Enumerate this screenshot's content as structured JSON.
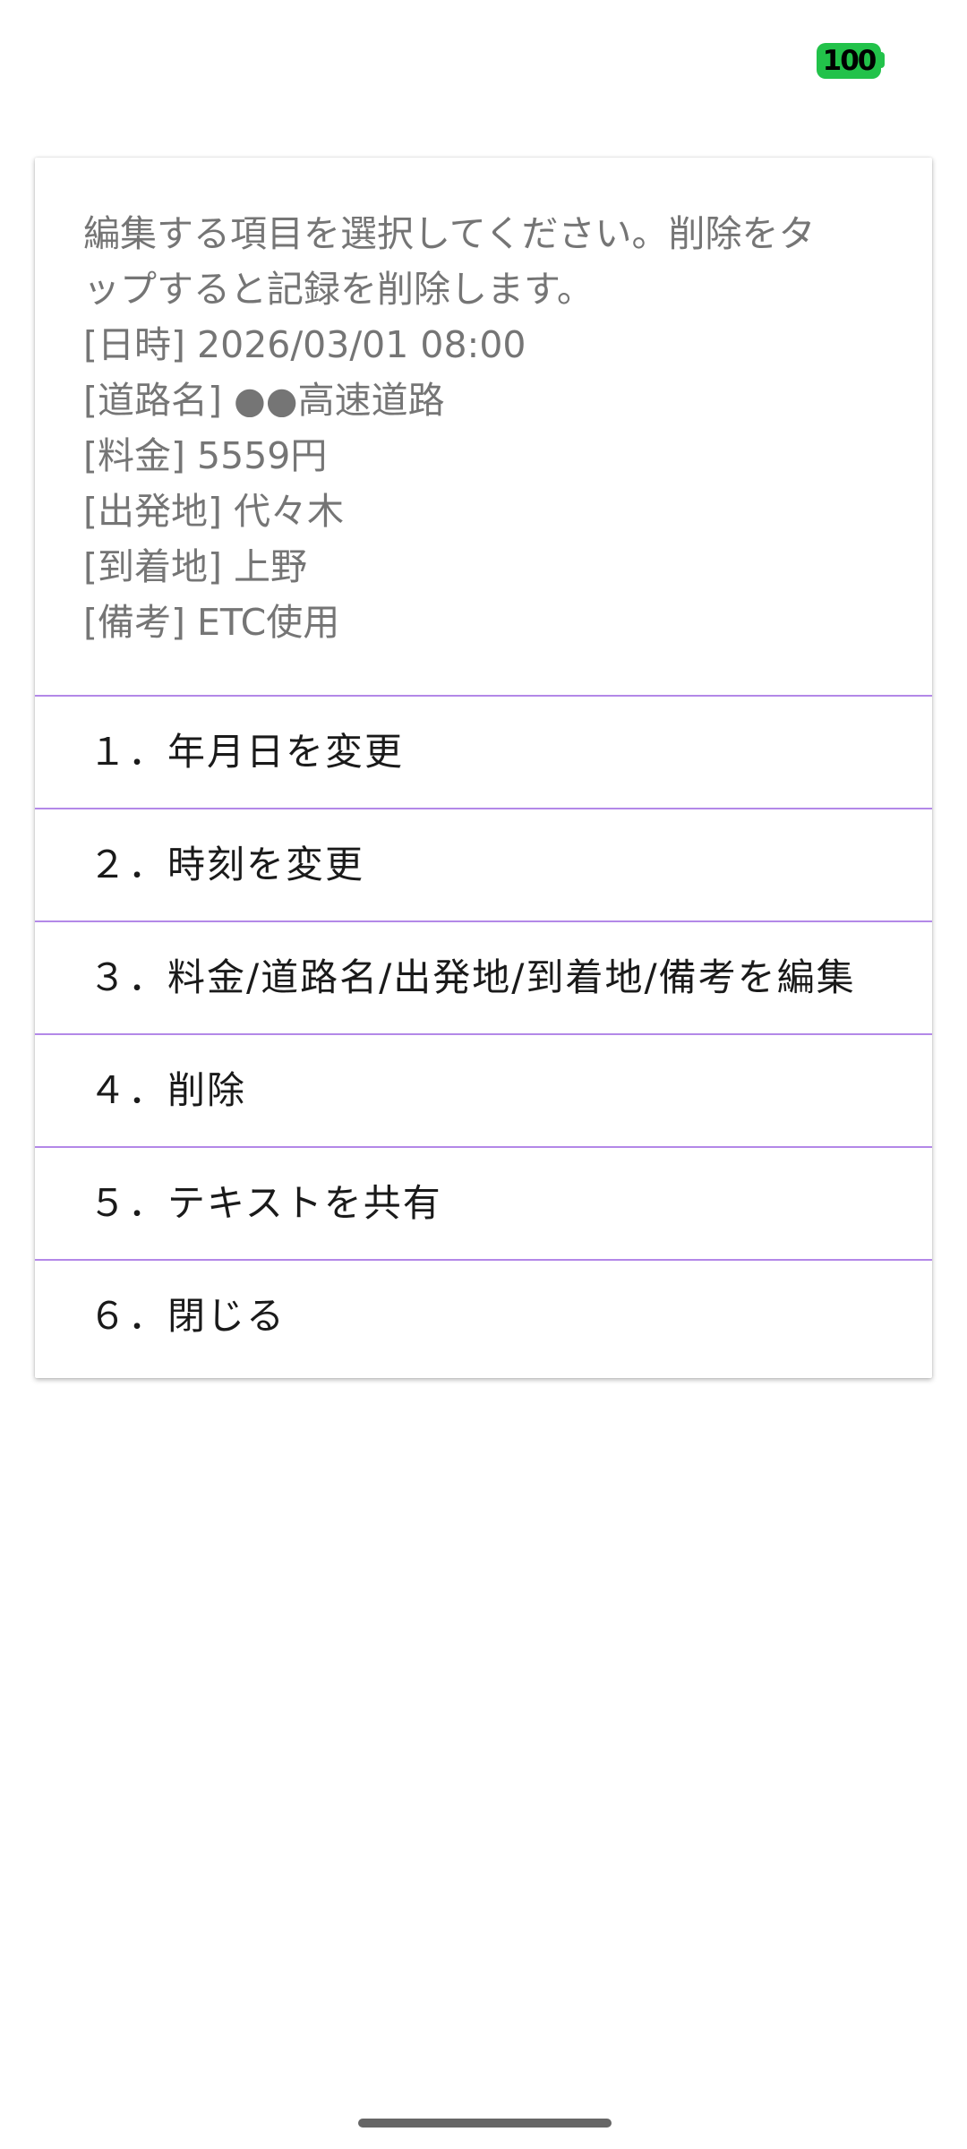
{
  "status_bar": {
    "battery_level": "100",
    "battery_color": "#22c24a"
  },
  "dialog": {
    "message_lines": [
      "編集する項目を選択してください。削除をタ",
      "ップすると記録を削除します。",
      "[日時] 2026/03/01 08:00",
      "[道路名] ●●高速道路",
      "[料金] 5559円",
      "[出発地] 代々木",
      "[到着地] 上野",
      "[備考] ETC使用"
    ],
    "options": [
      "１．年月日を変更",
      "２．時刻を変更",
      "３．料金/道路名/出発地/到着地/備考を編集",
      "４．削除",
      "５．テキストを共有",
      "６．閉じる"
    ],
    "divider_color": "#b388e8"
  }
}
